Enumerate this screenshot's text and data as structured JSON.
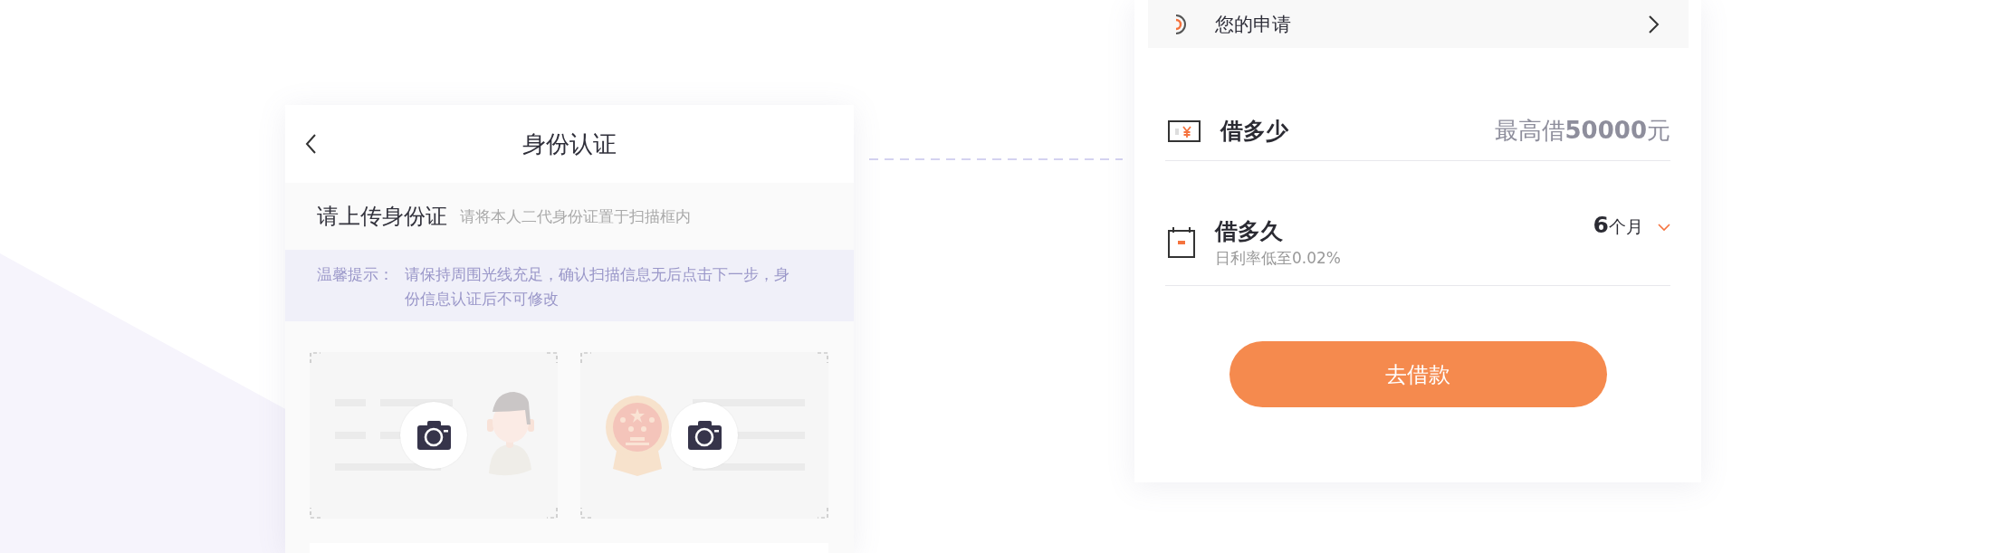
{
  "id_screen": {
    "title": "身份认证",
    "upload_heading": "请上传身份证",
    "upload_hint": "请将本人二代身份证置于扫描框内",
    "tip": {
      "label": "温馨提示：",
      "text": "请保持周围光线充足，确认扫描信息无后点击下一步，身份信息认证后不可修改"
    },
    "scan_frames": [
      {
        "kind": "portrait"
      },
      {
        "kind": "emblem"
      }
    ]
  },
  "loan_screen": {
    "application": {
      "label": "您的申请"
    },
    "fields": [
      {
        "kind": "amount",
        "label": "借多少",
        "value": "最高借**50000**元"
      },
      {
        "kind": "term",
        "label": "借多久",
        "sub": "日利率低至0.02%",
        "value": "**6**个月"
      }
    ],
    "button": "去借款"
  }
}
